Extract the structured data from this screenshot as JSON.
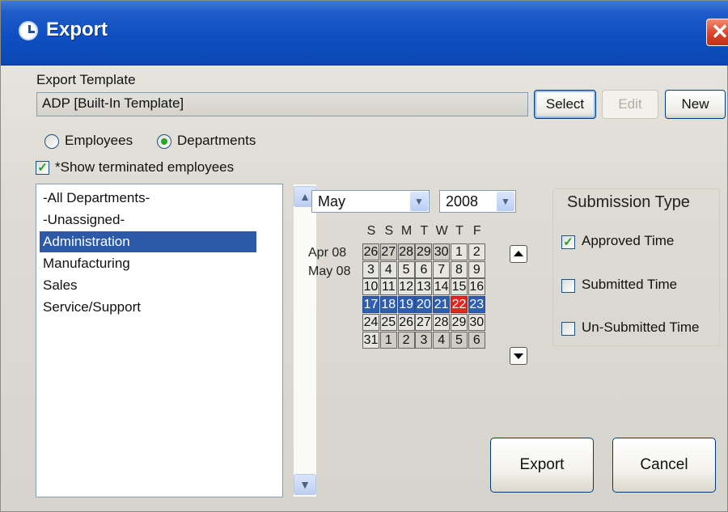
{
  "window": {
    "title": "Export",
    "close_label": "✕"
  },
  "template": {
    "label": "Export Template",
    "value": "ADP [Built-In Template]",
    "select_label": "Select",
    "edit_label": "Edit",
    "new_label": "New"
  },
  "filter": {
    "employees_label": "Employees",
    "departments_label": "Departments",
    "selected": "Departments",
    "show_terminated_label": "*Show terminated employees",
    "show_terminated_checked": true
  },
  "departments": [
    {
      "label": "-All Departments-",
      "selected": false
    },
    {
      "label": "-Unassigned-",
      "selected": false
    },
    {
      "label": "Administration",
      "selected": true
    },
    {
      "label": "Manufacturing",
      "selected": false
    },
    {
      "label": "Sales",
      "selected": false
    },
    {
      "label": "Service/Support",
      "selected": false
    }
  ],
  "calendar": {
    "month": "May",
    "year": "2008",
    "day_headers": [
      "S",
      "S",
      "M",
      "T",
      "W",
      "T",
      "F"
    ],
    "row_labels": [
      "Apr 08",
      "May 08"
    ],
    "weeks": [
      [
        "26",
        "27",
        "28",
        "29",
        "30",
        "1",
        "2"
      ],
      [
        "3",
        "4",
        "5",
        "6",
        "7",
        "8",
        "9"
      ],
      [
        "10",
        "11",
        "12",
        "13",
        "14",
        "15",
        "16"
      ],
      [
        "17",
        "18",
        "19",
        "20",
        "21",
        "22",
        "23"
      ],
      [
        "24",
        "25",
        "26",
        "27",
        "28",
        "29",
        "30"
      ],
      [
        "31",
        "1",
        "2",
        "3",
        "4",
        "5",
        "6"
      ]
    ],
    "selected_week": 3,
    "today": "22"
  },
  "submission": {
    "title": "Submission Type",
    "options": [
      {
        "label": "Approved Time",
        "checked": true
      },
      {
        "label": "Submitted Time",
        "checked": false
      },
      {
        "label": "Un-Submitted Time",
        "checked": false
      }
    ]
  },
  "actions": {
    "export_label": "Export",
    "cancel_label": "Cancel"
  },
  "colors": {
    "titlebar": "#0f4fc1",
    "selection": "#2c5aa8",
    "today": "#e3261f",
    "check": "#21a121"
  }
}
